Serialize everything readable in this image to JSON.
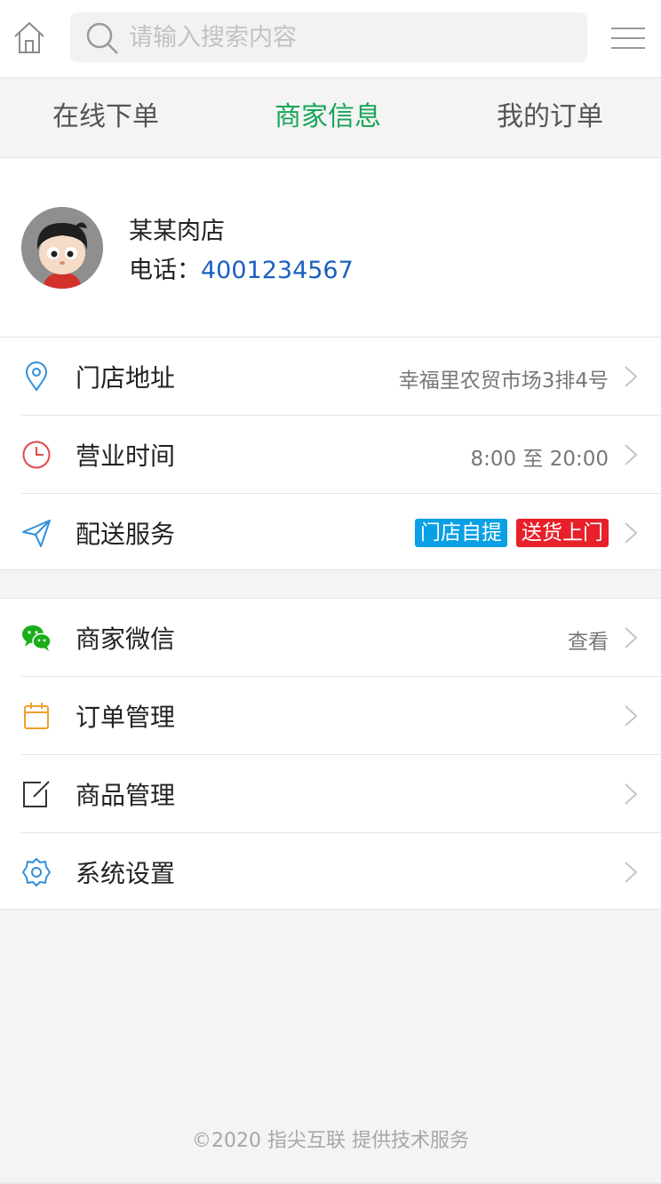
{
  "header": {
    "home_icon": "home-icon",
    "search_placeholder": "请输入搜索内容",
    "menu_icon": "hamburger-menu-icon"
  },
  "tabs": [
    {
      "label": "在线下单",
      "active": false
    },
    {
      "label": "商家信息",
      "active": true
    },
    {
      "label": "我的订单",
      "active": false
    }
  ],
  "shop": {
    "name": "某某肉店",
    "phone_label": "电话：",
    "phone": "4001234567"
  },
  "info_rows": {
    "address": {
      "icon": "location-pin-icon",
      "label": "门店地址",
      "value": "幸福里农贸市场3排4号"
    },
    "hours": {
      "icon": "clock-icon",
      "label": "营业时间",
      "value": "8:00 至 20:00"
    },
    "delivery": {
      "icon": "send-icon",
      "label": "配送服务",
      "badges": [
        "门店自提",
        "送货上门"
      ]
    }
  },
  "menu_rows": {
    "wechat": {
      "icon": "wechat-icon",
      "label": "商家微信",
      "value": "查看"
    },
    "orders": {
      "icon": "calendar-icon",
      "label": "订单管理"
    },
    "products": {
      "icon": "edit-icon",
      "label": "商品管理"
    },
    "settings": {
      "icon": "gear-icon",
      "label": "系统设置"
    }
  },
  "colors": {
    "accent": "#18a558",
    "phone": "#1b5fbf",
    "badge_blue": "#0aa0e6",
    "badge_red": "#e8202a"
  },
  "footer": {
    "text": "©2020 指尖互联 提供技术服务"
  }
}
